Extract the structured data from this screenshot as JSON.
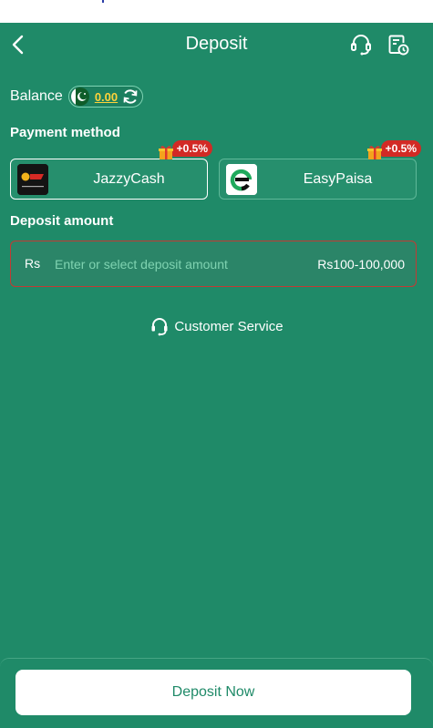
{
  "header": {
    "title": "Deposit",
    "back_icon": "chevron-left-icon",
    "support_icon": "headset-icon",
    "history_icon": "record-history-icon"
  },
  "balance": {
    "label": "Balance",
    "value": "0.00",
    "flag_icon": "pakistan-flag-icon",
    "refresh_icon": "refresh-icon"
  },
  "payment": {
    "title": "Payment method",
    "methods": [
      {
        "name": "JazzyCash",
        "bonus": "+0.5%",
        "selected": true,
        "logo_text": "Jazz Cash",
        "logo_sub": "Business"
      },
      {
        "name": "EasyPaisa",
        "bonus": "+0.5%",
        "selected": false
      }
    ]
  },
  "deposit": {
    "title": "Deposit amount",
    "currency": "Rs",
    "placeholder": "Enter or select deposit amount",
    "range": "Rs100-100,000"
  },
  "customer_service": {
    "label": "Customer Service"
  },
  "submit": {
    "label": "Deposit Now"
  },
  "colors": {
    "background": "#1f8a68",
    "balance_value": "#ffd23a",
    "bonus_badge": "#d22a25",
    "field_error_border": "#c23a34"
  }
}
